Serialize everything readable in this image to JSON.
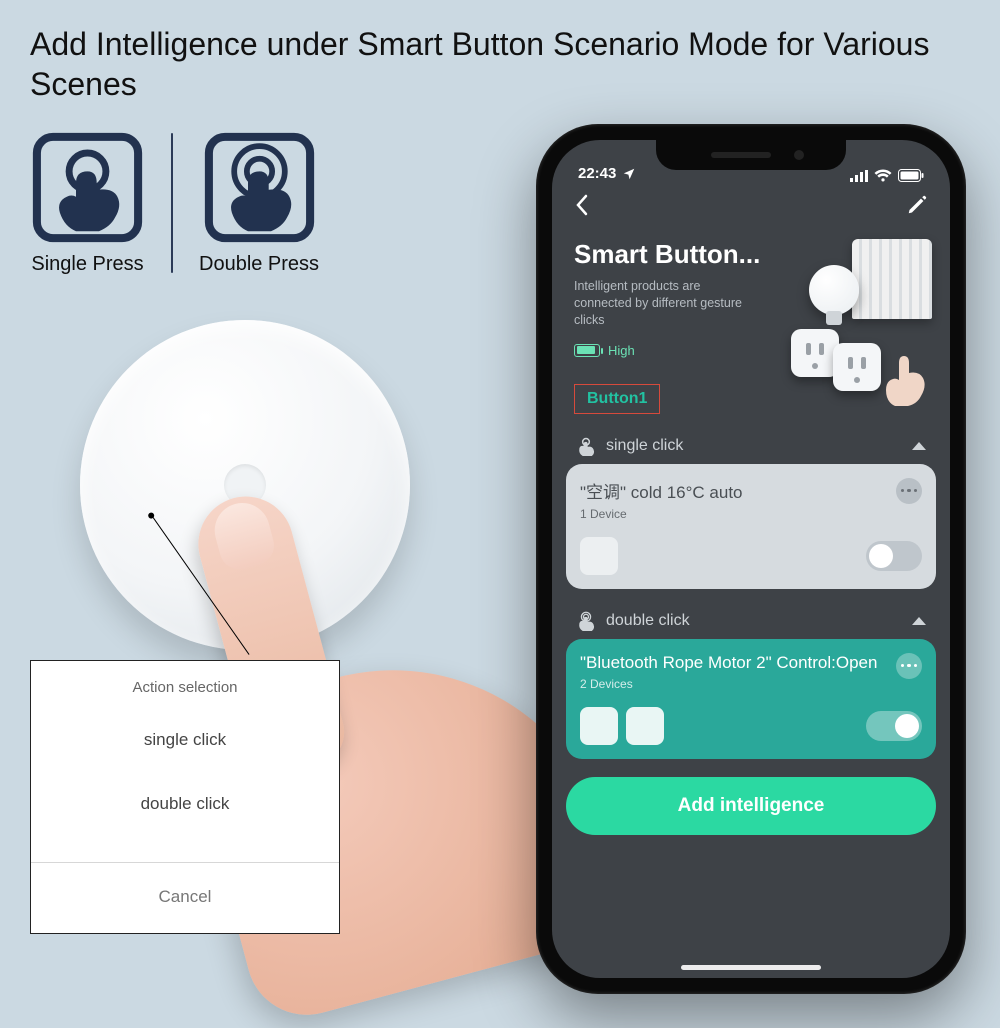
{
  "headline": "Add Intelligence under Smart Button Scenario Mode for Various Scenes",
  "press": {
    "single": "Single Press",
    "double": "Double Press"
  },
  "action_sheet": {
    "title": "Action selection",
    "single": "single click",
    "double": "double click",
    "cancel": "Cancel"
  },
  "phone": {
    "status": {
      "time": "22:43"
    },
    "hero": {
      "title": "Smart Button...",
      "subtitle": "Intelligent products are connected by different gesture clicks",
      "battery": "High"
    },
    "button_chip": "Button1",
    "sections": {
      "single": {
        "header": "single click",
        "card_title": "\"空调\" cold 16°C auto",
        "card_sub": "1 Device"
      },
      "double": {
        "header": "double click",
        "card_title": "\"Bluetooth Rope Motor 2\" Control:Open",
        "card_sub": "2 Devices"
      }
    },
    "cta": "Add intelligence"
  }
}
